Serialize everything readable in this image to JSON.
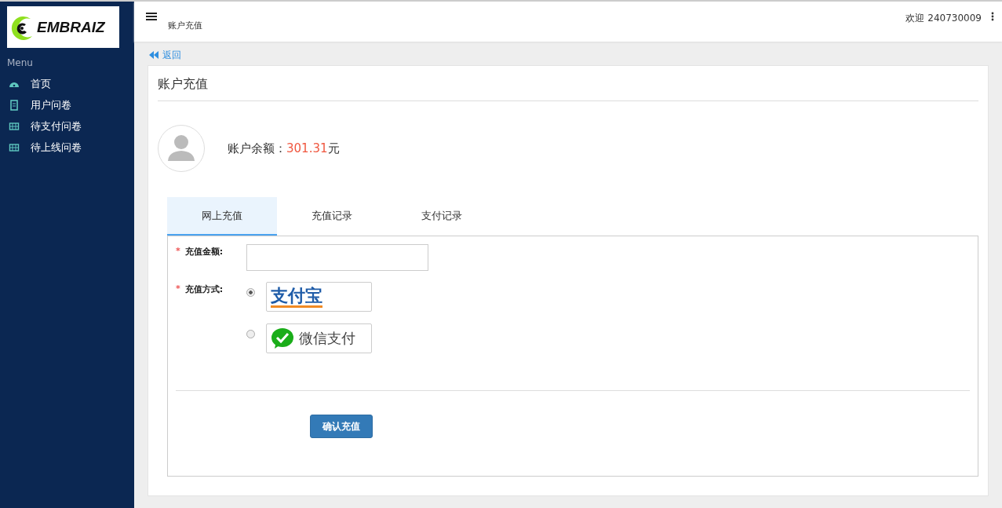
{
  "sidebar": {
    "logo_text": "EMBRAIZ",
    "menu_title": "Menu",
    "items": [
      {
        "label": "首页",
        "kind": "gauge"
      },
      {
        "label": "用户问卷",
        "kind": "doc"
      },
      {
        "label": "待支付问卷",
        "kind": "table"
      },
      {
        "label": "待上线问卷",
        "kind": "table"
      }
    ]
  },
  "header": {
    "breadcrumb": "账户充值",
    "welcome": "欢迎 240730009"
  },
  "back_link": "返回",
  "panel": {
    "title": "账户充值",
    "balance_label": "账户余额：",
    "balance_value": "301.31",
    "balance_unit": "元",
    "tabs": [
      {
        "label": "网上充值",
        "selected": true
      },
      {
        "label": "充值记录",
        "selected": false
      },
      {
        "label": "支付记录",
        "selected": false
      }
    ],
    "form": {
      "amount_label": "充值金额:",
      "method_label": "充值方式:",
      "required_mark": "*",
      "methods": [
        {
          "kind": "alipay",
          "label": "支付宝",
          "selected": true
        },
        {
          "kind": "wechat",
          "label": "微信支付",
          "selected": false
        }
      ],
      "submit": "确认充值"
    }
  }
}
